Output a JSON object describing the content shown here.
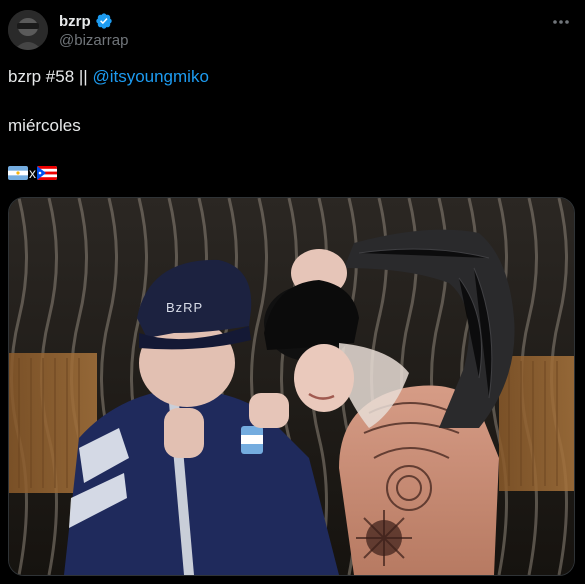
{
  "tweet": {
    "author": {
      "display_name": "bzrp",
      "handle": "@bizarrap",
      "verified": true,
      "avatar_icon": "avatar-photo"
    },
    "text": {
      "line1_prefix": "bzrp #58 || ",
      "line1_mention": "@itsyoungmiko",
      "line2": "miércoles",
      "flags_separator": "x",
      "flags": [
        "argentina-flag-icon",
        "puerto-rico-flag-icon"
      ]
    },
    "media": {
      "cap_text": "BzRP"
    },
    "colors": {
      "background": "#000000",
      "text": "#e7e9ea",
      "secondary": "#71767b",
      "accent": "#1d9bf0"
    }
  }
}
